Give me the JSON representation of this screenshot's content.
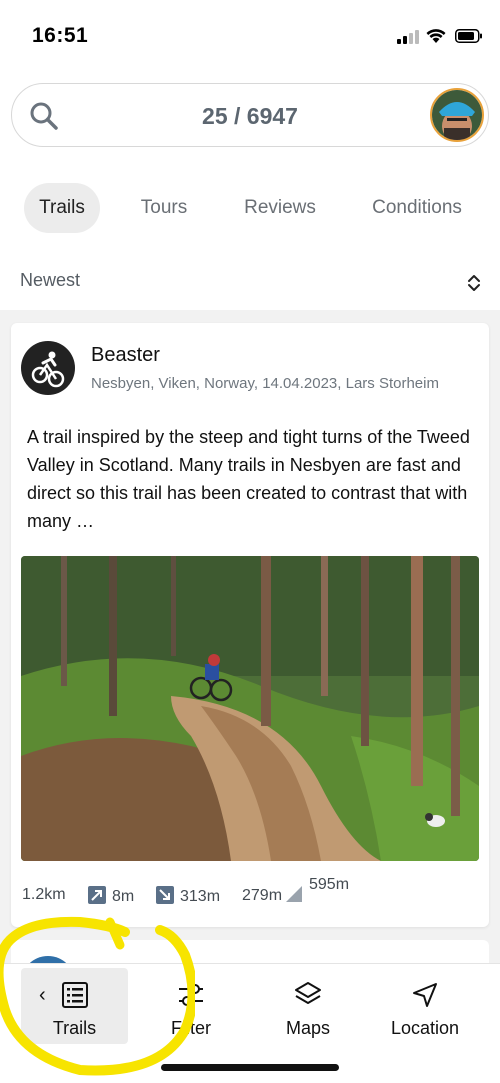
{
  "status_bar": {
    "time": "16:51"
  },
  "search": {
    "count": "25 / 6947"
  },
  "tabs": [
    {
      "label": "Trails",
      "active": true
    },
    {
      "label": "Tours",
      "active": false
    },
    {
      "label": "Reviews",
      "active": false
    },
    {
      "label": "Conditions",
      "active": false
    }
  ],
  "sort": {
    "label": "Newest"
  },
  "trail_card": {
    "title": "Beaster",
    "meta": "Nesbyen, Viken, Norway, 14.04.2023, Lars Storheim",
    "description": "A trail inspired by the steep and tight turns of the Tweed Valley in Scotland. Many trails in Nesbyen are fast and direct so this trail has been created to contrast that with many …",
    "stats": {
      "distance": "1.2km",
      "climb": "8m",
      "descent": "313m",
      "elevation_min": "279m",
      "elevation_max": "595m"
    }
  },
  "bottom_nav": [
    {
      "label": "Trails",
      "icon": "list-icon",
      "active": true
    },
    {
      "label": "Filter",
      "icon": "sliders-icon",
      "active": false
    },
    {
      "label": "Maps",
      "icon": "layers-icon",
      "active": false
    },
    {
      "label": "Location",
      "icon": "navigation-arrow-icon",
      "active": false
    }
  ],
  "colors": {
    "highlight": "#f7e400",
    "stat_icon": "#5a6f87",
    "avatar_border": "#e9a23b"
  }
}
